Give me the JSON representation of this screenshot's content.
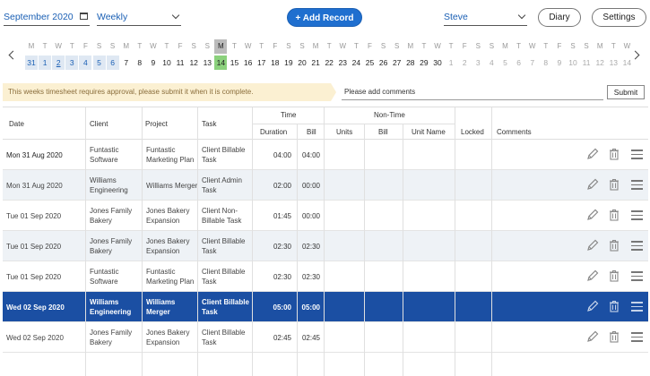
{
  "topbar": {
    "month": "September 2020",
    "view": "Weekly",
    "add_record": "+ Add Record",
    "user": "Steve",
    "diary": "Diary",
    "settings": "Settings"
  },
  "calendar": {
    "days": [
      {
        "l": "M",
        "n": "31",
        "s": "prev"
      },
      {
        "l": "T",
        "n": "1",
        "s": "prev"
      },
      {
        "l": "W",
        "n": "2",
        "s": "prev ul"
      },
      {
        "l": "T",
        "n": "3",
        "s": "prev"
      },
      {
        "l": "F",
        "n": "4",
        "s": "prev"
      },
      {
        "l": "S",
        "n": "5",
        "s": "prev"
      },
      {
        "l": "S",
        "n": "6",
        "s": "prev"
      },
      {
        "l": "M",
        "n": "7",
        "s": ""
      },
      {
        "l": "T",
        "n": "8",
        "s": ""
      },
      {
        "l": "W",
        "n": "9",
        "s": ""
      },
      {
        "l": "T",
        "n": "10",
        "s": ""
      },
      {
        "l": "F",
        "n": "11",
        "s": ""
      },
      {
        "l": "S",
        "n": "12",
        "s": ""
      },
      {
        "l": "S",
        "n": "13",
        "s": ""
      },
      {
        "l": "M",
        "n": "14",
        "s": "today"
      },
      {
        "l": "T",
        "n": "15",
        "s": ""
      },
      {
        "l": "W",
        "n": "16",
        "s": ""
      },
      {
        "l": "T",
        "n": "17",
        "s": ""
      },
      {
        "l": "F",
        "n": "18",
        "s": ""
      },
      {
        "l": "S",
        "n": "19",
        "s": ""
      },
      {
        "l": "S",
        "n": "20",
        "s": ""
      },
      {
        "l": "M",
        "n": "21",
        "s": ""
      },
      {
        "l": "T",
        "n": "22",
        "s": ""
      },
      {
        "l": "W",
        "n": "23",
        "s": ""
      },
      {
        "l": "T",
        "n": "24",
        "s": ""
      },
      {
        "l": "F",
        "n": "25",
        "s": ""
      },
      {
        "l": "S",
        "n": "26",
        "s": ""
      },
      {
        "l": "S",
        "n": "27",
        "s": ""
      },
      {
        "l": "M",
        "n": "28",
        "s": ""
      },
      {
        "l": "T",
        "n": "29",
        "s": ""
      },
      {
        "l": "W",
        "n": "30",
        "s": ""
      },
      {
        "l": "T",
        "n": "1",
        "s": "future"
      },
      {
        "l": "F",
        "n": "2",
        "s": "future"
      },
      {
        "l": "S",
        "n": "3",
        "s": "future"
      },
      {
        "l": "S",
        "n": "4",
        "s": "future"
      },
      {
        "l": "M",
        "n": "5",
        "s": "future"
      },
      {
        "l": "T",
        "n": "6",
        "s": "future"
      },
      {
        "l": "W",
        "n": "7",
        "s": "future"
      },
      {
        "l": "T",
        "n": "8",
        "s": "future"
      },
      {
        "l": "F",
        "n": "9",
        "s": "future"
      },
      {
        "l": "S",
        "n": "10",
        "s": "future"
      },
      {
        "l": "S",
        "n": "11",
        "s": "future"
      },
      {
        "l": "M",
        "n": "12",
        "s": "future"
      },
      {
        "l": "T",
        "n": "13",
        "s": "future"
      },
      {
        "l": "W",
        "n": "14",
        "s": "future"
      }
    ]
  },
  "approval": {
    "notice": "This weeks timesheet requires approval, please submit it when it is complete.",
    "comments_placeholder": "Please add comments",
    "submit": "Submit"
  },
  "table": {
    "headers": {
      "date": "Date",
      "client": "Client",
      "project": "Project",
      "task": "Task",
      "time": "Time",
      "duration": "Duration",
      "bill": "Bill",
      "non_time": "Non-Time",
      "units": "Units",
      "nt_bill": "Bill",
      "unit_name": "Unit Name",
      "locked": "Locked",
      "comments": "Comments"
    },
    "rows": [
      {
        "date": "Mon 31 Aug 2020",
        "client": "Funtastic Software",
        "project": "Funtastic Marketing Plan",
        "task": "Client Billable Task",
        "duration": "04:00",
        "bill": "04:00",
        "style": "first"
      },
      {
        "date": "Mon 31 Aug 2020",
        "client": "Williams Engineering",
        "project": "Williams Merger",
        "task": "Client Admin Task",
        "duration": "02:00",
        "bill": "00:00",
        "style": "alt"
      },
      {
        "date": "Tue 01 Sep 2020",
        "client": "Jones Family Bakery",
        "project": "Jones Bakery Expansion",
        "task": "Client Non-Billable Task",
        "duration": "01:45",
        "bill": "00:00",
        "style": ""
      },
      {
        "date": "Tue 01 Sep 2020",
        "client": "Jones Family Bakery",
        "project": "Jones Bakery Expansion",
        "task": "Client Billable Task",
        "duration": "02:30",
        "bill": "02:30",
        "style": "alt"
      },
      {
        "date": "Tue 01 Sep 2020",
        "client": "Funtastic Software",
        "project": "Funtastic Marketing Plan",
        "task": "Client Billable Task",
        "duration": "02:30",
        "bill": "02:30",
        "style": ""
      },
      {
        "date": "Wed 02 Sep 2020",
        "client": "Williams Engineering",
        "project": "Williams Merger",
        "task": "Client Billable Task",
        "duration": "05:00",
        "bill": "05:00",
        "style": "sel"
      },
      {
        "date": "Wed 02 Sep 2020",
        "client": "Jones Family Bakery",
        "project": "Jones Bakery Expansion",
        "task": "Client Billable Task",
        "duration": "02:45",
        "bill": "02:45",
        "style": ""
      }
    ]
  },
  "colors": {
    "accent": "#1f6fcf",
    "selected_row": "#1b4fa3",
    "today": "#8bd17c",
    "notice_bg": "#fbf0d2"
  }
}
